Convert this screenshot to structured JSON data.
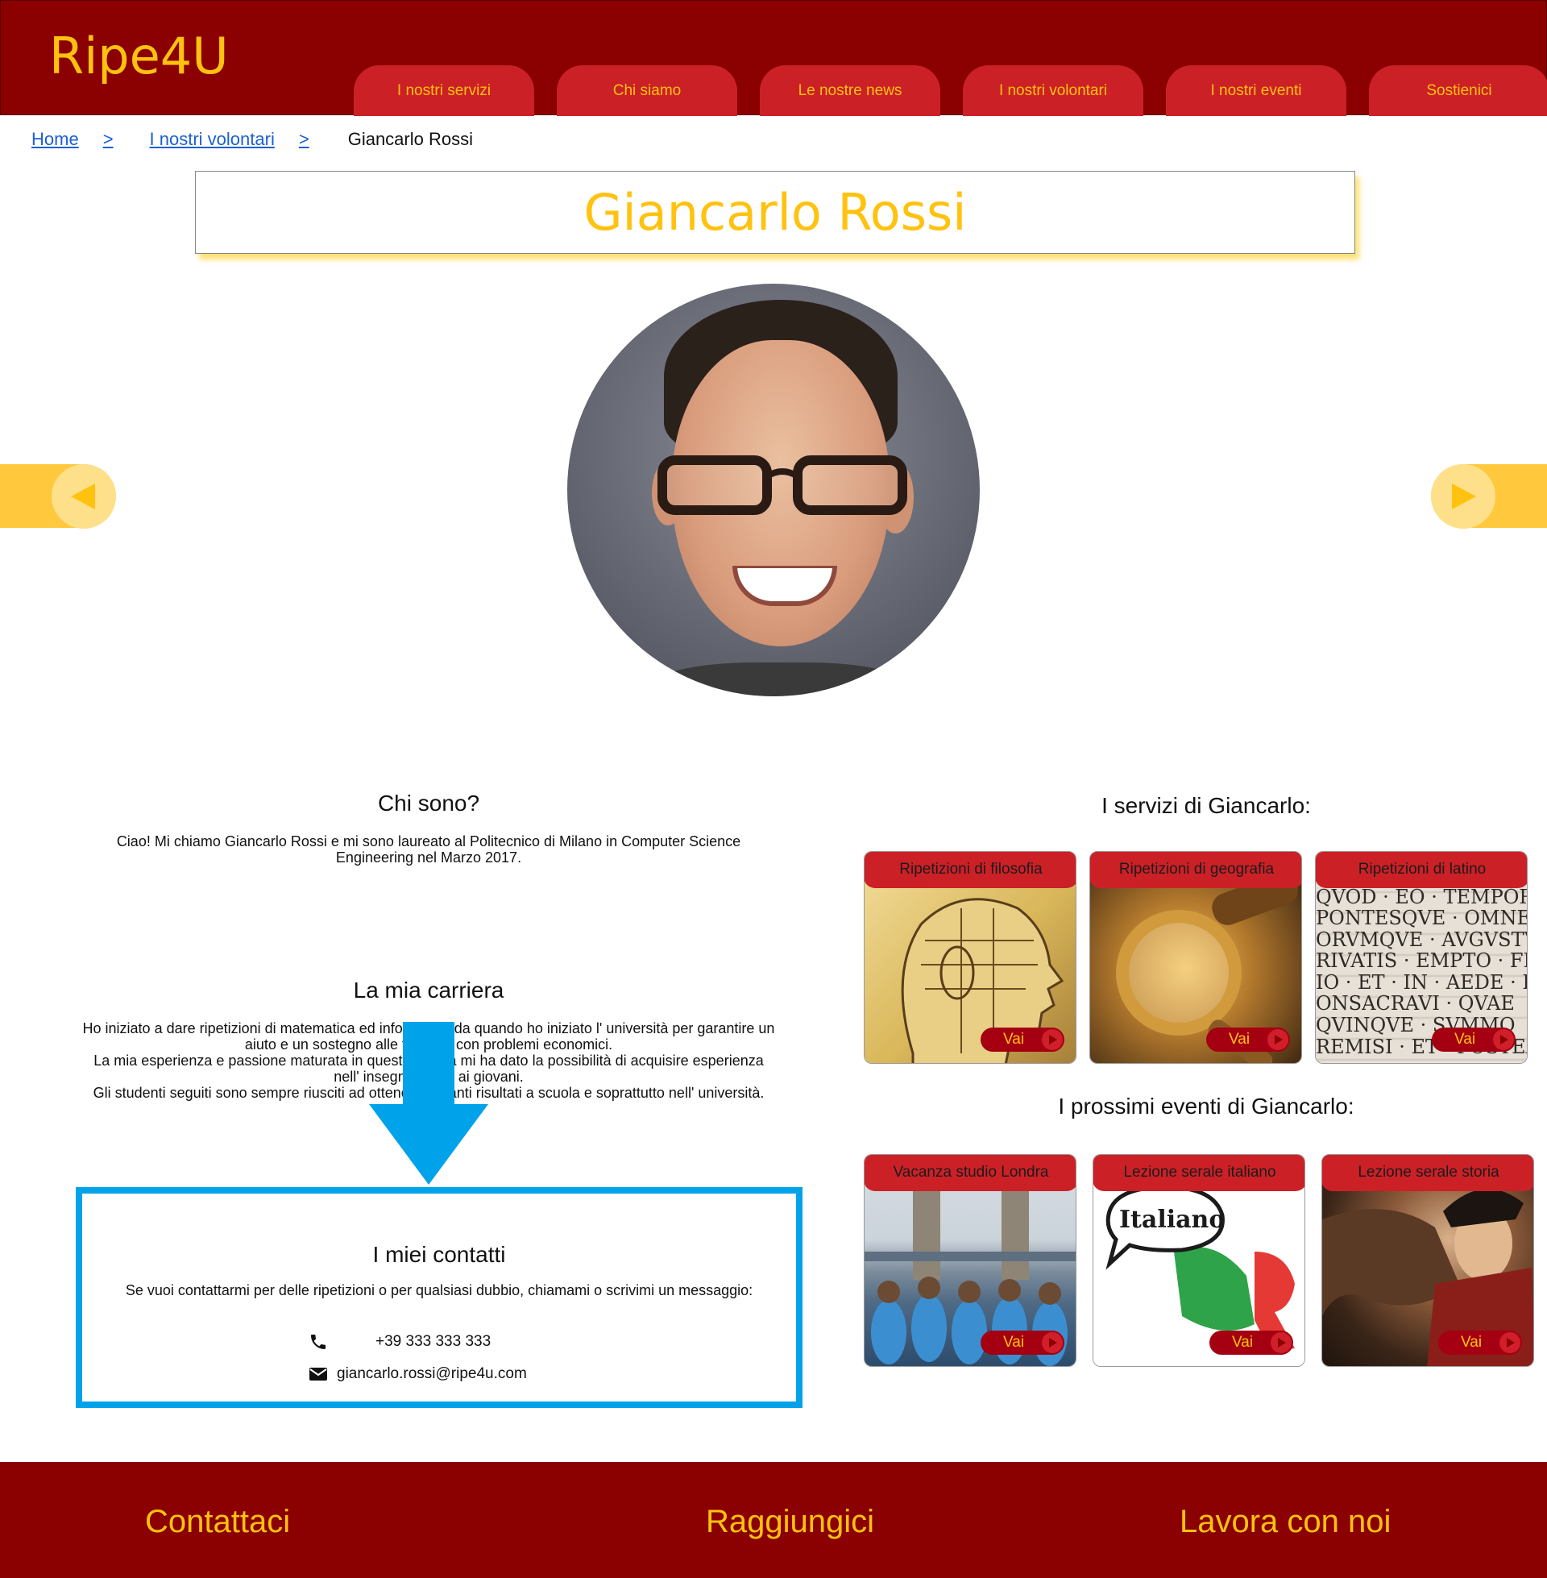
{
  "header": {
    "logo": "Ripe4U",
    "nav": [
      {
        "label": "I nostri servizi"
      },
      {
        "label": "Chi siamo"
      },
      {
        "label": "Le nostre news"
      },
      {
        "label": "I nostri volontari"
      },
      {
        "label": "I nostri eventi"
      },
      {
        "label": "Sostienici"
      }
    ]
  },
  "breadcrumb": {
    "home": "Home",
    "sep": ">",
    "volontari": "I nostri volontari",
    "current": "Giancarlo Rossi"
  },
  "profile": {
    "name": "Giancarlo Rossi"
  },
  "about": {
    "heading": "Chi sono?",
    "text": "Ciao! Mi chiamo Giancarlo Rossi e mi sono laureato al Politecnico di Milano in Computer Science Engineering nel Marzo 2017."
  },
  "career": {
    "heading": "La mia carriera",
    "lines": [
      "Ho iniziato a dare ripetizioni di matematica ed informatica da quando ho iniziato l' università per garantire un aiuto e un sostegno alle famiglie con problemi economici.",
      "La mia esperienza e passione maturata in queste attività  mi ha dato la possibilità di acquisire esperienza nell' insegnamento ai giovani.",
      "Gli studenti seguiti sono sempre riusciti ad ottenere brillanti risultati a scuola e soprattutto nell' università."
    ]
  },
  "contacts": {
    "heading": "I miei contatti",
    "text": "Se vuoi contattarmi per delle ripetizioni o per qualsiasi dubbio, chiamami o scrivimi un messaggio:",
    "phone": "+39 333 333 333",
    "email": "giancarlo.rossi@ripe4u.com"
  },
  "services": {
    "heading": "I servizi di Giancarlo:",
    "items": [
      {
        "title": "Ripetizioni di filosofia",
        "button": "Vai"
      },
      {
        "title": "Ripetizioni di geografia",
        "button": "Vai"
      },
      {
        "title": "Ripetizioni di latino",
        "button": "Vai"
      }
    ]
  },
  "events": {
    "heading": "I prossimi eventi di Giancarlo:",
    "items": [
      {
        "title": "Vacanza studio Londra",
        "button": "Vai"
      },
      {
        "title": "Lezione serale italiano",
        "button": "Vai",
        "image_text": "Italiano"
      },
      {
        "title": "Lezione serale storia",
        "button": "Vai"
      }
    ]
  },
  "latin_image_text": [
    "QVOD · EO · TEMPOR",
    "PONTESQVE · OMNES",
    "ORVMQVE · AVGVSTV",
    "RIVATIS · EMPTO · FECI",
    "IO · ET · IN · AEDE · DI",
    "ONSACRAVI · QVAE",
    "QVINQVE · SVMMO",
    "REMISI · ET · POSTEA"
  ],
  "footer": {
    "links": [
      "Contattaci",
      "Raggiungici",
      "Lavora con noi"
    ]
  },
  "colors": {
    "header_bg": "#8b0000",
    "tab_bg": "#cc2027",
    "accent_yellow": "#ffc20e",
    "highlight_blue": "#00a3ea"
  },
  "icons": [
    "phone-icon",
    "mail-icon",
    "arrow-left-icon",
    "arrow-right-icon",
    "play-icon"
  ]
}
